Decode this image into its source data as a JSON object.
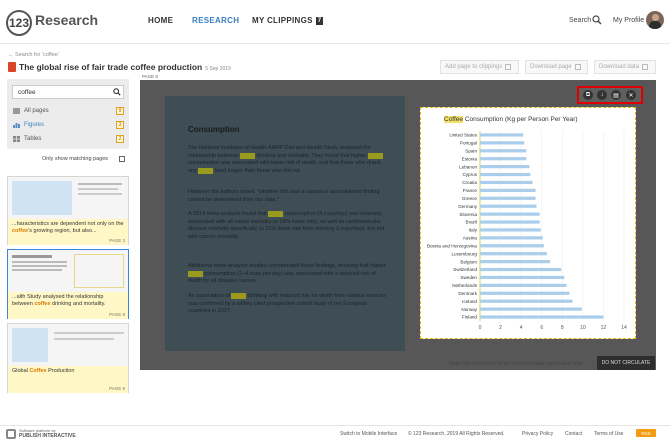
{
  "header": {
    "logo_number": "123",
    "logo_text": "Research",
    "nav": [
      "HOME",
      "RESEARCH",
      "MY CLIPPINGS"
    ],
    "clippings_count": "7",
    "search_label": "Search",
    "profile_label": "My Profile"
  },
  "back_link": "Search for 'coffee'",
  "document": {
    "title": "The global rise of fair trade coffee production",
    "date": "5 Sep 2019"
  },
  "toolbar": {
    "add_clippings": "Add page to clippings",
    "download_page": "Download page",
    "download_data": "Download data"
  },
  "filter": {
    "query": "coffee",
    "rows": [
      {
        "label": "All pages",
        "count": "9"
      },
      {
        "label": "Figures",
        "count": "3"
      },
      {
        "label": "Tables",
        "count": "2"
      }
    ],
    "only_matching": "Only show matching pages"
  },
  "thumbnails": [
    {
      "pre": "...haracteristics are dependent not only on the ",
      "kw": "coffee",
      "post": "'s growing region, but also...",
      "page": "PAGE 3"
    },
    {
      "pre": "...alth Study analysed the relationship between ",
      "kw": "coffee",
      "post": " drinking and mortality.",
      "page": "PAGE 8"
    },
    {
      "pre": "Global ",
      "kw": "Coffee",
      "post": " Production",
      "page": "PAGE 9"
    }
  ],
  "viewer": {
    "page_label": "PAGE 8",
    "heading": "Consumption",
    "paragraphs": [
      [
        "The National Institutes of Health-AARP Diet and Health Study analysed the relationship between ",
        "coffee",
        " drinking and mortality. They found that higher ",
        "coffee",
        " consumption was associated with lower risk of death, and that those who drank any ",
        "coffee",
        " lived longer than those who did not."
      ],
      [
        "However the authors noted, \"whether this was a causal or associational finding cannot be determined from our data.\""
      ],
      [
        "A 2014 meta-analysis found that ",
        "coffee",
        " consumption (4 cups/day) was inversely associated with all-cause mortality (a 16% lower risk), as well as cardiovascular disease mortality specifically (a 21% lower risk from drinking 3 cups/day), but not with cancer mortality."
      ],
      [
        "Additional meta-analysis studies corroborated these findings, showing that higher ",
        "coffee",
        " consumption (2–4 cups per day) was associated with a reduced risk of death by all disease causes."
      ],
      [
        "An association of ",
        "coffee",
        " drinking with reduced risk for death from various sources was confirmed by a widely cited prospective cohort study of ten European countries in 2017."
      ]
    ],
    "demo_note": "Note this document is for demonstration purposes only.",
    "not_circulate": "DO NOT CIRCULATE"
  },
  "chart_data": {
    "type": "bar",
    "orientation": "horizontal",
    "title_keyword": "Coffee",
    "title": " Consumption (Kg per Person Per Year)",
    "categories": [
      "United States",
      "Portugal",
      "Spain",
      "Estonia",
      "Lebanon",
      "Cyprus",
      "Croatia",
      "France",
      "Greece",
      "Germany",
      "Slovenia",
      "Brazil",
      "Italy",
      "Austria",
      "Bosnia and Herzegovina",
      "Luxembourg",
      "Belgium",
      "Switzerland",
      "Sweden",
      "Netherlands",
      "Denmark",
      "Iceland",
      "Norway",
      "Finland"
    ],
    "values": [
      4.2,
      4.3,
      4.5,
      4.5,
      4.8,
      4.9,
      5.1,
      5.4,
      5.4,
      5.5,
      5.8,
      5.8,
      5.9,
      6.1,
      6.2,
      6.5,
      6.8,
      7.9,
      8.2,
      8.4,
      8.7,
      9.0,
      9.9,
      12.0
    ],
    "xticks": [
      0,
      2,
      4,
      6,
      8,
      10,
      12,
      14
    ],
    "xlim": [
      0,
      14
    ],
    "grid": true,
    "bar_color": "#aacdeb"
  },
  "footer": {
    "platform": "Software platform by",
    "publisher": "PUBLISH INTERACTIVE",
    "links": [
      "Switch to Mobile Interface",
      "© 123 Research, 2019 All Rights Reserved.",
      "Privacy Policy",
      "Contact",
      "Terms of Use"
    ],
    "rss": "RSS"
  },
  "colors": {
    "accent": "#3a7fc1",
    "highlight": "#d97a00",
    "callout": "#e00000"
  }
}
